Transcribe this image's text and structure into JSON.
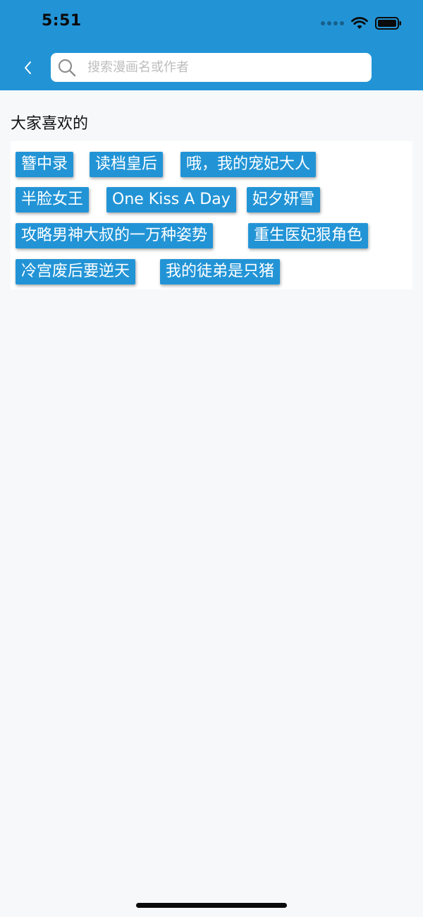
{
  "status_bar": {
    "time": "5:51"
  },
  "header": {
    "background_color": "#2294d6",
    "back_icon": "chevron-left-icon",
    "search": {
      "placeholder": "搜索漫画名或作者",
      "value": "",
      "icon": "search-icon"
    }
  },
  "section": {
    "title": "大家喜欢的",
    "tags": [
      "簪中录",
      "读档皇后",
      "哦，我的宠妃大人",
      "半脸女王",
      "One Kiss A Day",
      "妃夕妍雪",
      "攻略男神大叔的一万种姿势",
      "重生医妃狠角色",
      "冷宫废后要逆天",
      "我的徒弟是只猪"
    ]
  },
  "colors": {
    "accent": "#2294d6",
    "page_background": "#f6f8fa",
    "panel_background": "#ffffff"
  }
}
